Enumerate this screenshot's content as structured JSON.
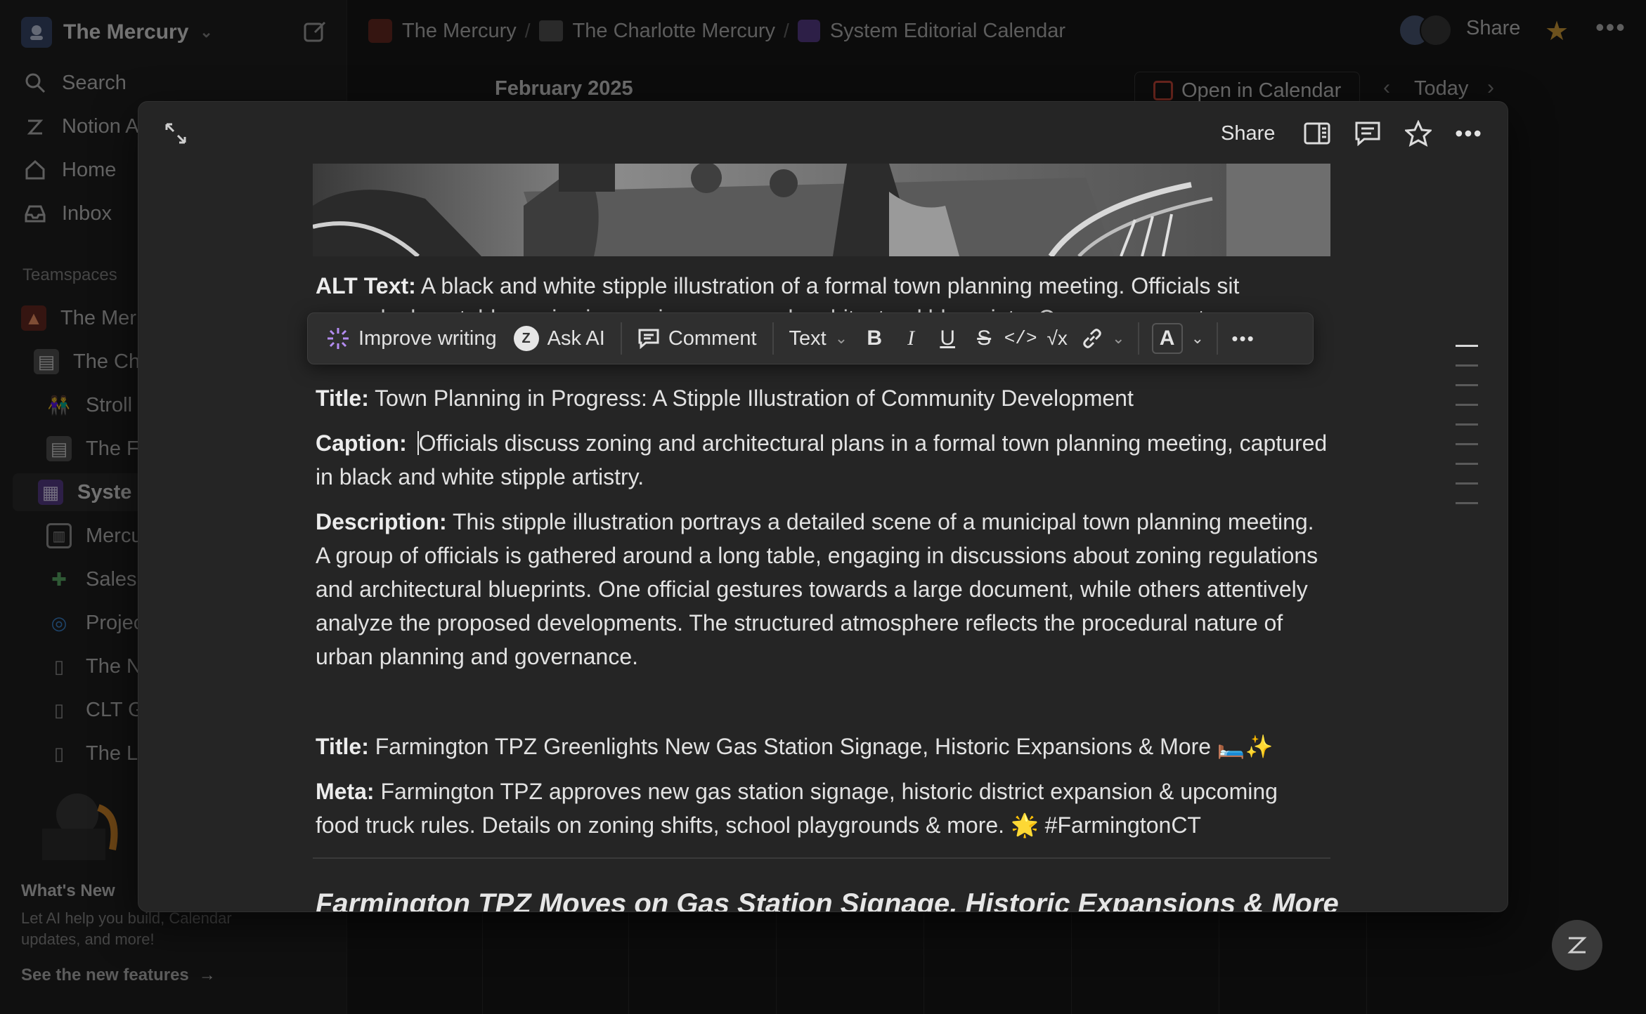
{
  "workspace": {
    "name": "The Mercury"
  },
  "sidebar": {
    "nav": [
      {
        "label": "Search",
        "icon": "search-icon"
      },
      {
        "label": "Notion A",
        "icon": "notion-ai-icon"
      },
      {
        "label": "Home",
        "icon": "home-icon"
      },
      {
        "label": "Inbox",
        "icon": "inbox-icon"
      }
    ],
    "section_label": "Teamspaces",
    "tree": [
      {
        "label": "The Mer",
        "icon": "flame-icon"
      },
      {
        "label": "The Ch",
        "icon": "newspaper-icon"
      },
      {
        "label": "Stroll",
        "icon": "people-icon"
      },
      {
        "label": "The F",
        "icon": "newspaper-icon"
      },
      {
        "label": "Syste",
        "icon": "calendar-icon"
      },
      {
        "label": "Mercu",
        "icon": "table-icon"
      },
      {
        "label": "Sales",
        "icon": "puzzle-icon"
      },
      {
        "label": "Projec",
        "icon": "target-icon"
      },
      {
        "label": "The N",
        "icon": "page-icon"
      },
      {
        "label": "CLT G",
        "icon": "page-icon"
      },
      {
        "label": "The L",
        "icon": "page-icon"
      }
    ],
    "whats_new": {
      "title": "What's New",
      "body": "Let AI help you build, Calendar updates, and more!",
      "link": "See the new features"
    }
  },
  "topbar": {
    "breadcrumbs": [
      "The Mercury",
      "The Charlotte Mercury",
      "System Editorial Calendar"
    ],
    "share": "Share"
  },
  "calendar_header": {
    "month": "February 2025",
    "open_in_calendar": "Open in Calendar",
    "today": "Today"
  },
  "modal": {
    "share": "Share",
    "toolbar": {
      "improve_writing": "Improve writing",
      "ask_ai": "Ask AI",
      "comment": "Comment",
      "text": "Text",
      "color_letter": "A"
    },
    "alt_text": {
      "label": "ALT Text:",
      "text": "A black and white stipple illustration of a formal town planning meeting. Officials sit",
      "cut_line": "around a long table, reviewing zoning maps and architectural blueprints. One person gestures"
    },
    "blocks": [
      {
        "label": "Title:",
        "text": "Town Planning in Progress: A Stipple Illustration of Community Development"
      },
      {
        "label": "Caption:",
        "text": "Officials discuss zoning and architectural plans in a formal town planning meeting, captured in black and white stipple artistry."
      },
      {
        "label": "Description:",
        "text": "This stipple illustration portrays a detailed scene of a municipal town planning meeting. A group of officials is gathered around a long table, engaging in discussions about zoning regulations and architectural blueprints. One official gestures towards a large document, while others attentively analyze the proposed developments. The structured atmosphere reflects the procedural nature of urban planning and governance."
      },
      {
        "label": "Title:",
        "text": "Farmington TPZ Greenlights New Gas Station Signage, Historic Expansions & More 🛏️✨"
      },
      {
        "label": "Meta:",
        "text": "Farmington TPZ approves new gas station signage, historic district expansion & upcoming food truck rules. Details on zoning shifts, school playgrounds & more. 🌟 #FarmingtonCT"
      }
    ],
    "heading": "Farmington TPZ Moves on Gas Station Signage, Historic Expansions & More"
  }
}
